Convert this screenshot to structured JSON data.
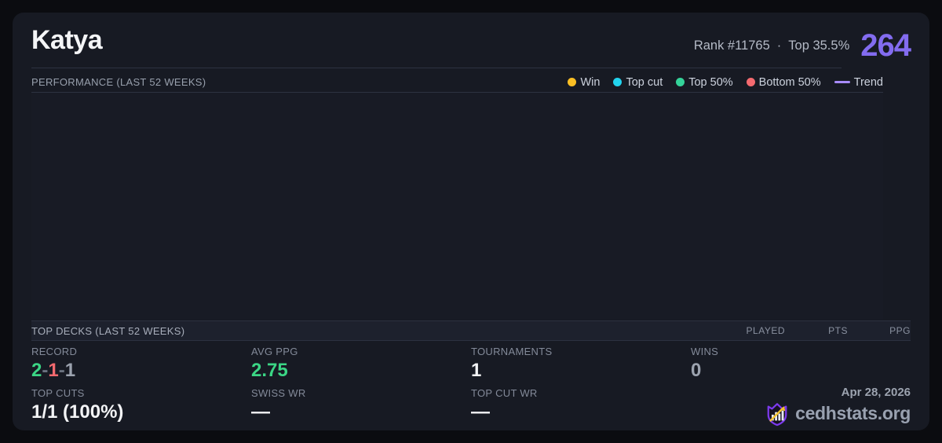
{
  "page": {
    "background": "#0b0c10",
    "card_background": "#171a23"
  },
  "header": {
    "title": "Katya",
    "rank_text": "Rank #11765",
    "separator": "·",
    "top_percent_text": "Top 35.5%",
    "score": "264",
    "score_color": "#836cf0"
  },
  "performance": {
    "heading": "PERFORMANCE (LAST 52 WEEKS)",
    "legend": [
      {
        "id": "win",
        "label": "Win",
        "color": "#fbbf24",
        "type": "dot"
      },
      {
        "id": "top-cut",
        "label": "Top cut",
        "color": "#22d3ee",
        "type": "dot"
      },
      {
        "id": "top-50",
        "label": "Top 50%",
        "color": "#34d399",
        "type": "dot"
      },
      {
        "id": "bottom-50",
        "label": "Bottom 50%",
        "color": "#f46a6f",
        "type": "dot"
      },
      {
        "id": "trend",
        "label": "Trend",
        "color": "#a78bfa",
        "type": "line"
      }
    ]
  },
  "top_decks": {
    "heading": "TOP DECKS (LAST 52 WEEKS)",
    "columns": [
      "PLAYED",
      "PTS",
      "PPG"
    ]
  },
  "stats": {
    "record": {
      "label": "RECORD",
      "wins": "2",
      "losses": "1",
      "draws": "1",
      "sep": "-"
    },
    "avg_ppg": {
      "label": "AVG PPG",
      "value": "2.75"
    },
    "tournaments": {
      "label": "TOURNAMENTS",
      "value": "1"
    },
    "wins": {
      "label": "WINS",
      "value": "0"
    },
    "top_cuts": {
      "label": "TOP CUTS",
      "value": "1/1 (100%)"
    },
    "swiss_wr": {
      "label": "SWISS WR",
      "value": "—"
    },
    "top_cut_wr": {
      "label": "TOP CUT WR",
      "value": "—"
    }
  },
  "footer": {
    "date": "Apr 28, 2026",
    "brand": "cedhstats.org"
  }
}
